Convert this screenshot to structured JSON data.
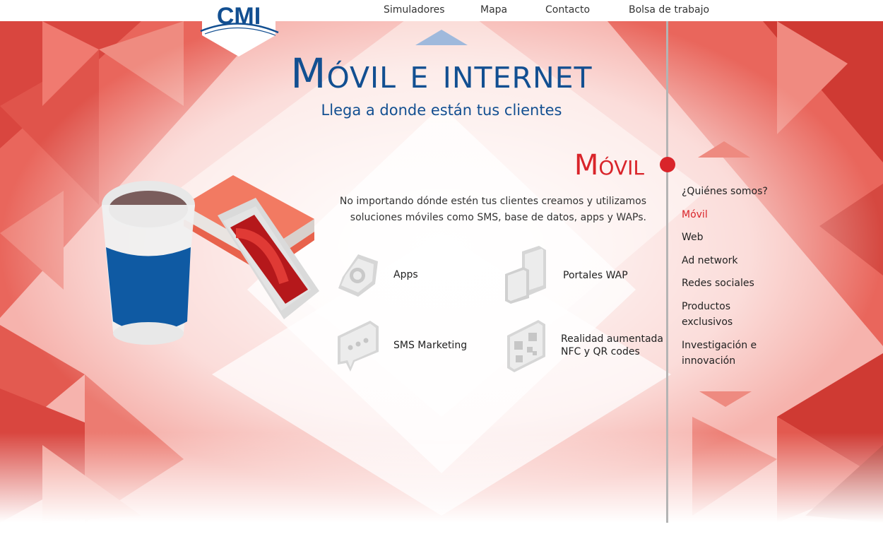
{
  "header": {
    "logo_text": "CMI",
    "nav": [
      "Simuladores",
      "Mapa",
      "Contacto",
      "Bolsa de trabajo"
    ]
  },
  "hero": {
    "title": "Móvil e internet",
    "subtitle": "Llega a donde están tus clientes"
  },
  "section": {
    "title": "Móvil",
    "intro_line1": "No importando dónde estén tus clientes creamos y utilizamos",
    "intro_line2": "soluciones móviles como SMS, base de datos, apps y WAPs."
  },
  "services": [
    {
      "label": "Apps",
      "icon": "hexagon-nut-icon"
    },
    {
      "label": "Portales WAP",
      "icon": "wap-portal-icon"
    },
    {
      "label": "SMS Marketing",
      "icon": "chat-bubble-icon"
    },
    {
      "label_line1": "Realidad aumentada",
      "label_line2": "NFC y QR codes",
      "icon": "qr-code-icon"
    }
  ],
  "sidebar": {
    "items": [
      {
        "label": "¿Quiénes somos?"
      },
      {
        "label": "Móvil",
        "active": true
      },
      {
        "label": "Web"
      },
      {
        "label": "Ad network"
      },
      {
        "label": "Redes sociales"
      },
      {
        "label_line1": "Productos",
        "label_line2": "exclusivos"
      },
      {
        "label_line1": "Investigación e",
        "label_line2": "innovación"
      }
    ],
    "scroll_up": "triangle-up-icon",
    "scroll_down": "triangle-down-icon"
  },
  "colors": {
    "brand_blue": "#124f91",
    "accent_red": "#d9242a",
    "divider": "#b4b4b4"
  }
}
